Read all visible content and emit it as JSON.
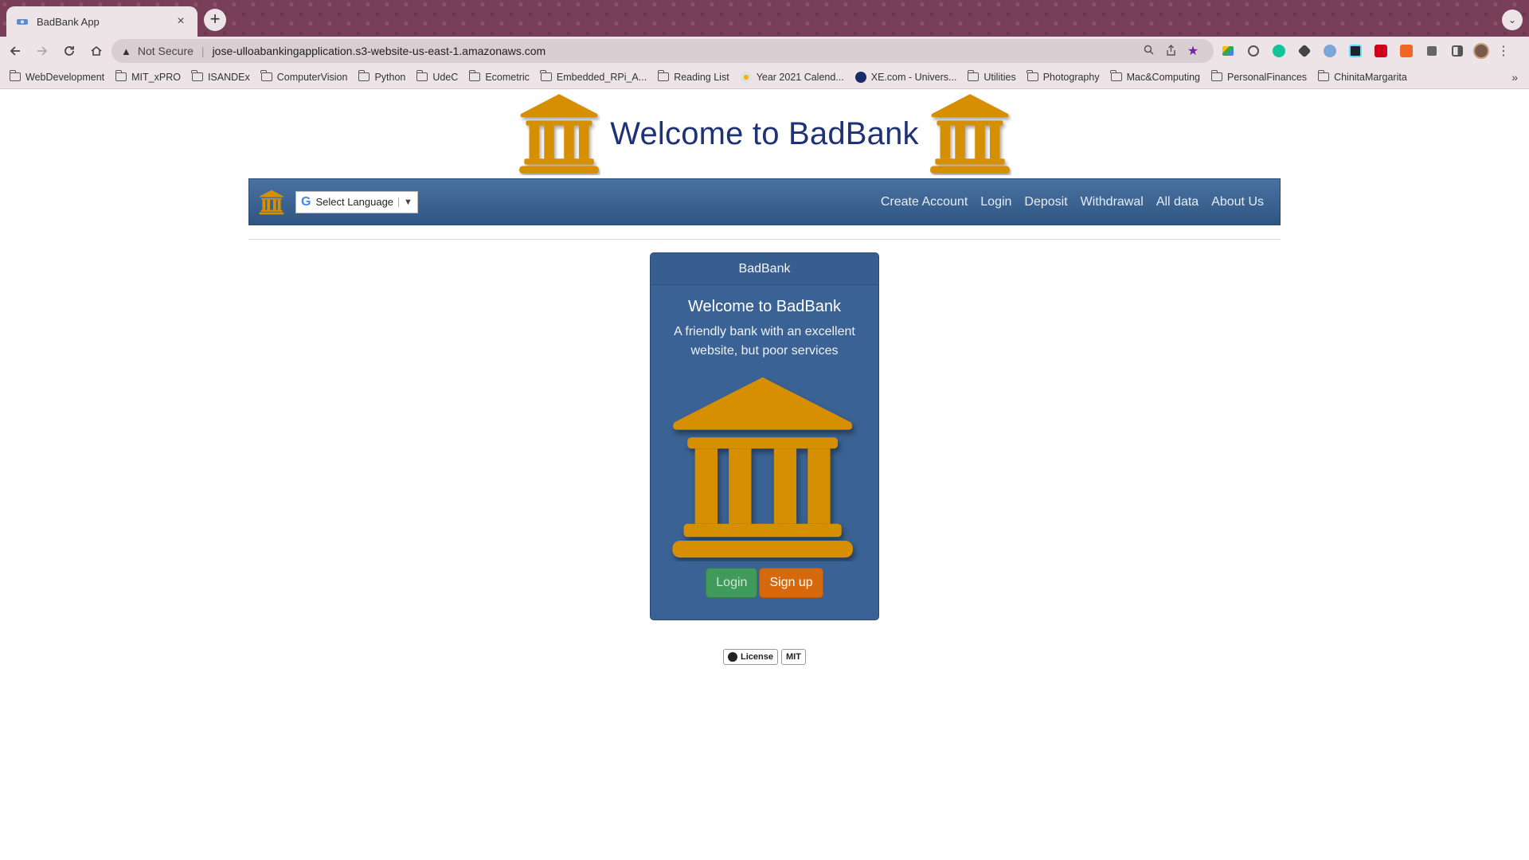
{
  "browser": {
    "tab_title": "BadBank App",
    "tab_close": "×",
    "new_tab": "+",
    "tab_menu": "⌄",
    "security_label": "Not Secure",
    "url": "jose-ulloabankingapplication.s3-website-us-east-1.amazonaws.com",
    "bookmarks": [
      "WebDevelopment",
      "MIT_xPRO",
      "ISANDEx",
      "ComputerVision",
      "Python",
      "UdeC",
      "Ecometric",
      "Embedded_RPi_A...",
      "Reading List",
      "Year 2021 Calend...",
      "XE.com - Univers...",
      "Utilities",
      "Photography",
      "Mac&Computing",
      "PersonalFinances",
      "ChinitaMargarita"
    ],
    "bookmarks_more": "»"
  },
  "hero": {
    "title": "Welcome to BadBank"
  },
  "navbar": {
    "language_label": "Select Language",
    "language_arrow": "▼",
    "google_g": "G",
    "links": [
      "Create Account",
      "Login",
      "Deposit",
      "Withdrawal",
      "All data",
      "About Us"
    ]
  },
  "card": {
    "header": "BadBank",
    "title": "Welcome to BadBank",
    "text": "A friendly bank with an excellent website, but poor services",
    "login_button": "Login",
    "signup_button": "Sign up"
  },
  "badge": {
    "left": "License",
    "right": "MIT"
  },
  "colors": {
    "brand_gold": "#d68f00",
    "nav_blue": "#3a6294",
    "title_blue": "#1f3276",
    "login_green": "#3f9a5b",
    "signup_orange": "#d6690e"
  },
  "icons": {
    "bank": "bank-building-icon",
    "back": "arrow-left-icon",
    "forward": "arrow-right-icon",
    "reload": "reload-icon",
    "home": "home-icon"
  }
}
